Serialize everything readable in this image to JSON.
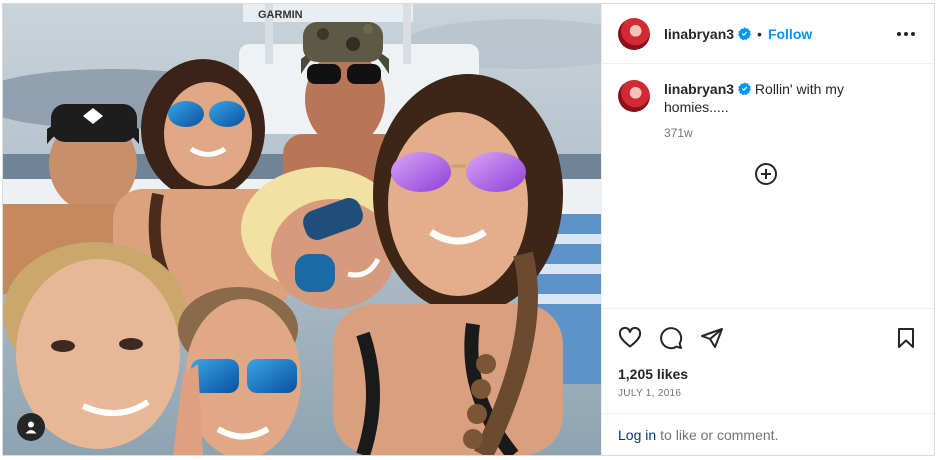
{
  "post": {
    "username": "linabryan3",
    "follow_label": "Follow",
    "separator": "•",
    "caption": "Rollin' with my homies.....",
    "time_ago": "371w",
    "likes": "1,205 likes",
    "date": "JULY 1, 2016",
    "login_link": "Log in",
    "login_suffix": "to like or comment.",
    "photo_boat_text": "GARMIN"
  },
  "colors": {
    "accent": "#0095f6",
    "text": "#262626",
    "muted": "#737373",
    "link": "#00376b",
    "border": "#dbdbdb"
  },
  "icons": {
    "more": "more-options-icon",
    "verified": "verified-badge-icon",
    "add_comment": "plus-circle-icon",
    "like": "heart-icon",
    "comment": "comment-icon",
    "share": "send-icon",
    "save": "bookmark-icon",
    "user": "user-icon"
  }
}
